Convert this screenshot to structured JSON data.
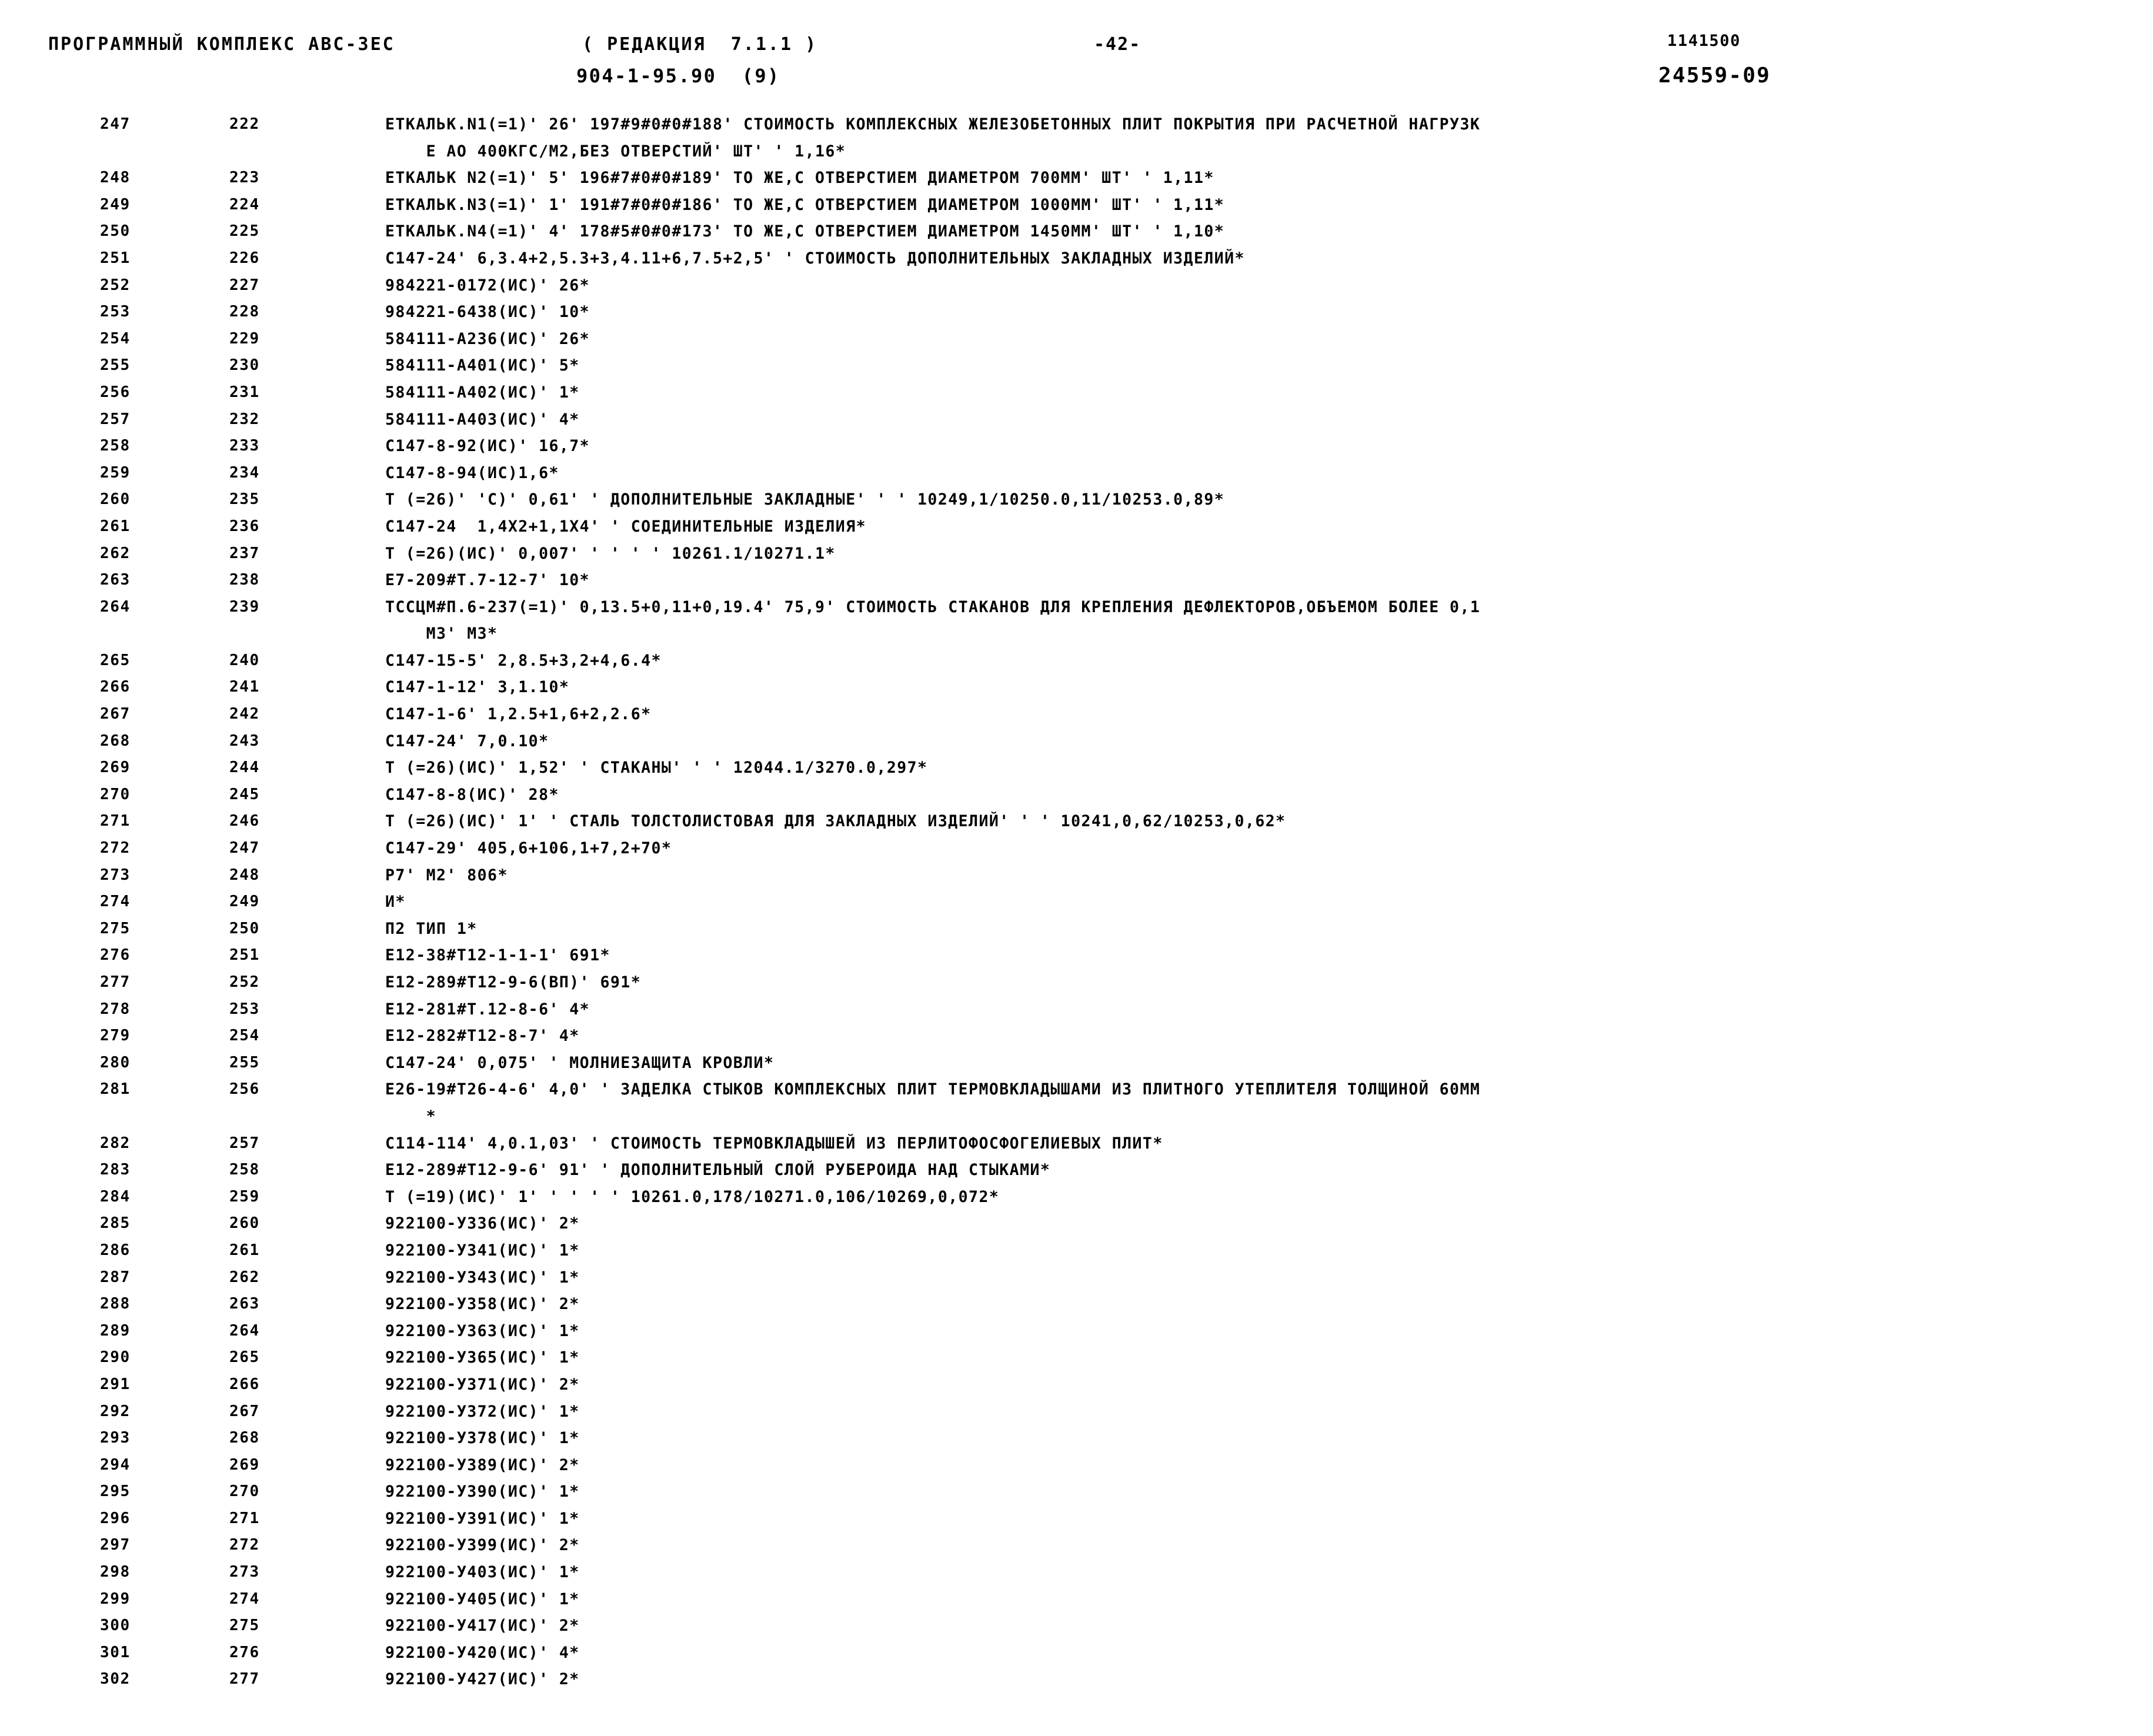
{
  "header": {
    "program_title": "ПРОГРАММНЫЙ КОМПЛЕКС АВС-3ЕС",
    "revision": "( РЕДАКЦИЯ  7.1.1 )",
    "series": "904-1-95.90  (9)",
    "page_marker": "-42-",
    "code_top": "1141500",
    "code_bottom": "24559-09"
  },
  "listing": {
    "columns": [
      "seq",
      "num",
      "text"
    ],
    "rows": [
      {
        "a": "247",
        "b": "222",
        "t": "ЕТКАЛЬК.N1(=1)' 26' 197#9#0#0#188' СТОИМОСТЬ КОМПЛЕКСНЫХ ЖЕЛЕЗОБЕТОННЫХ ПЛИТ ПОКРЫТИЯ ПРИ РАСЧЕТНОЙ НАГРУЗК"
      },
      {
        "a": "",
        "b": "",
        "t": "    Е АО 400КГС/М2,БЕЗ ОТВЕРСТИЙ' ШТ' ' 1,16*",
        "indent": true
      },
      {
        "a": "248",
        "b": "223",
        "t": "ЕТКАЛЬК N2(=1)' 5' 196#7#0#0#189' ТО ЖЕ,С ОТВЕРСТИЕМ ДИАМЕТРОМ 700ММ' ШТ' ' 1,11*"
      },
      {
        "a": "249",
        "b": "224",
        "t": "ЕТКАЛЬК.N3(=1)' 1' 191#7#0#0#186' ТО ЖЕ,С ОТВЕРСТИЕМ ДИАМЕТРОМ 1000ММ' ШТ' ' 1,11*"
      },
      {
        "a": "250",
        "b": "225",
        "t": "ЕТКАЛЬК.N4(=1)' 4' 178#5#0#0#173' ТО ЖЕ,С ОТВЕРСТИЕМ ДИАМЕТРОМ 1450ММ' ШТ' ' 1,10*"
      },
      {
        "a": "251",
        "b": "226",
        "t": "С147-24' 6,3.4+2,5.3+3,4.11+6,7.5+2,5' ' СТОИМОСТЬ ДОПОЛНИТЕЛЬНЫХ ЗАКЛАДНЫХ ИЗДЕЛИЙ*"
      },
      {
        "a": "252",
        "b": "227",
        "t": "984221-0172(ИС)' 26*"
      },
      {
        "a": "253",
        "b": "228",
        "t": "984221-6438(ИС)' 10*"
      },
      {
        "a": "254",
        "b": "229",
        "t": "584111-А236(ИС)' 26*"
      },
      {
        "a": "255",
        "b": "230",
        "t": "584111-А401(ИС)' 5*"
      },
      {
        "a": "256",
        "b": "231",
        "t": "584111-А402(ИС)' 1*"
      },
      {
        "a": "257",
        "b": "232",
        "t": "584111-А403(ИС)' 4*"
      },
      {
        "a": "258",
        "b": "233",
        "t": "С147-8-92(ИС)' 16,7*"
      },
      {
        "a": "259",
        "b": "234",
        "t": "С147-8-94(ИС)1,6*"
      },
      {
        "a": "260",
        "b": "235",
        "t": "Т (=26)' 'С)' 0,61' ' ДОПОЛНИТЕЛЬНЫЕ ЗАКЛАДНЫЕ' ' ' 10249,1/10250.0,11/10253.0,89*"
      },
      {
        "a": "261",
        "b": "236",
        "t": "С147-24  1,4Х2+1,1Х4' ' СОЕДИНИТЕЛЬНЫЕ ИЗДЕЛИЯ*"
      },
      {
        "a": "262",
        "b": "237",
        "t": "Т (=26)(ИС)' 0,007' ' ' ' ' 10261.1/10271.1*"
      },
      {
        "a": "263",
        "b": "238",
        "t": "Е7-209#Т.7-12-7' 10*"
      },
      {
        "a": "264",
        "b": "239",
        "t": "ТССЦМ#П.6-237(=1)' 0,13.5+0,11+0,19.4' 75,9' СТОИМОСТЬ СТАКАНОВ ДЛЯ КРЕПЛЕНИЯ ДЕФЛЕКТОРОВ,ОБЪЕМОМ БОЛЕЕ 0,1"
      },
      {
        "a": "",
        "b": "",
        "t": "    М3' М3*",
        "indent": true
      },
      {
        "a": "265",
        "b": "240",
        "t": "С147-15-5' 2,8.5+3,2+4,6.4*"
      },
      {
        "a": "266",
        "b": "241",
        "t": "С147-1-12' 3,1.10*"
      },
      {
        "a": "267",
        "b": "242",
        "t": "С147-1-6' 1,2.5+1,6+2,2.6*"
      },
      {
        "a": "268",
        "b": "243",
        "t": "С147-24' 7,0.10*"
      },
      {
        "a": "269",
        "b": "244",
        "t": "Т (=26)(ИС)' 1,52' ' СТАКАНЫ' ' ' 12044.1/3270.0,297*"
      },
      {
        "a": "270",
        "b": "245",
        "t": "С147-8-8(ИС)' 28*"
      },
      {
        "a": "271",
        "b": "246",
        "t": "Т (=26)(ИС)' 1' ' СТАЛЬ ТОЛСТОЛИСТОВАЯ ДЛЯ ЗАКЛАДНЫХ ИЗДЕЛИЙ' ' ' 10241,0,62/10253,0,62*"
      },
      {
        "a": "272",
        "b": "247",
        "t": "С147-29' 405,6+106,1+7,2+70*"
      },
      {
        "a": "273",
        "b": "248",
        "t": "Р7' М2' 806*"
      },
      {
        "a": "274",
        "b": "249",
        "t": "И*"
      },
      {
        "a": "275",
        "b": "250",
        "t": "П2 ТИП 1*"
      },
      {
        "a": "276",
        "b": "251",
        "t": "Е12-38#Т12-1-1-1' 691*"
      },
      {
        "a": "277",
        "b": "252",
        "t": "Е12-289#Т12-9-6(ВП)' 691*"
      },
      {
        "a": "278",
        "b": "253",
        "t": "Е12-281#Т.12-8-6' 4*"
      },
      {
        "a": "279",
        "b": "254",
        "t": "Е12-282#Т12-8-7' 4*"
      },
      {
        "a": "280",
        "b": "255",
        "t": "С147-24' 0,075' ' МОЛНИЕЗАЩИТА КРОВЛИ*"
      },
      {
        "a": "281",
        "b": "256",
        "t": "Е26-19#Т26-4-6' 4,0' ' ЗАДЕЛКА СТЫКОВ КОМПЛЕКСНЫХ ПЛИТ ТЕРМОВКЛАДЫШАМИ ИЗ ПЛИТНОГО УТЕПЛИТЕЛЯ ТОЛЩИНОЙ 60ММ"
      },
      {
        "a": "",
        "b": "",
        "t": "    *",
        "indent": true
      },
      {
        "a": "282",
        "b": "257",
        "t": "С114-114' 4,0.1,03' ' СТОИМОСТЬ ТЕРМОВКЛАДЫШЕЙ ИЗ ПЕРЛИТОФОСФОГЕЛИЕВЫХ ПЛИТ*"
      },
      {
        "a": "283",
        "b": "258",
        "t": "Е12-289#Т12-9-6' 91' ' ДОПОЛНИТЕЛЬНЫЙ СЛОЙ РУБЕРОИДА НАД СТЫКАМИ*"
      },
      {
        "a": "284",
        "b": "259",
        "t": "Т (=19)(ИС)' 1' ' ' ' ' 10261.0,178/10271.0,106/10269,0,072*"
      },
      {
        "a": "285",
        "b": "260",
        "t": "922100-У336(ИС)' 2*"
      },
      {
        "a": "286",
        "b": "261",
        "t": "922100-У341(ИС)' 1*"
      },
      {
        "a": "287",
        "b": "262",
        "t": "922100-У343(ИС)' 1*"
      },
      {
        "a": "288",
        "b": "263",
        "t": "922100-У358(ИС)' 2*"
      },
      {
        "a": "289",
        "b": "264",
        "t": "922100-У363(ИС)' 1*"
      },
      {
        "a": "290",
        "b": "265",
        "t": "922100-У365(ИС)' 1*"
      },
      {
        "a": "291",
        "b": "266",
        "t": "922100-У371(ИС)' 2*"
      },
      {
        "a": "292",
        "b": "267",
        "t": "922100-У372(ИС)' 1*"
      },
      {
        "a": "293",
        "b": "268",
        "t": "922100-У378(ИС)' 1*"
      },
      {
        "a": "294",
        "b": "269",
        "t": "922100-У389(ИС)' 2*"
      },
      {
        "a": "295",
        "b": "270",
        "t": "922100-У390(ИС)' 1*"
      },
      {
        "a": "296",
        "b": "271",
        "t": "922100-У391(ИС)' 1*"
      },
      {
        "a": "297",
        "b": "272",
        "t": "922100-У399(ИС)' 2*"
      },
      {
        "a": "298",
        "b": "273",
        "t": "922100-У403(ИС)' 1*"
      },
      {
        "a": "299",
        "b": "274",
        "t": "922100-У405(ИС)' 1*"
      },
      {
        "a": "300",
        "b": "275",
        "t": "922100-У417(ИС)' 2*"
      },
      {
        "a": "301",
        "b": "276",
        "t": "922100-У420(ИС)' 4*"
      },
      {
        "a": "302",
        "b": "277",
        "t": "922100-У427(ИС)' 2*"
      }
    ]
  }
}
